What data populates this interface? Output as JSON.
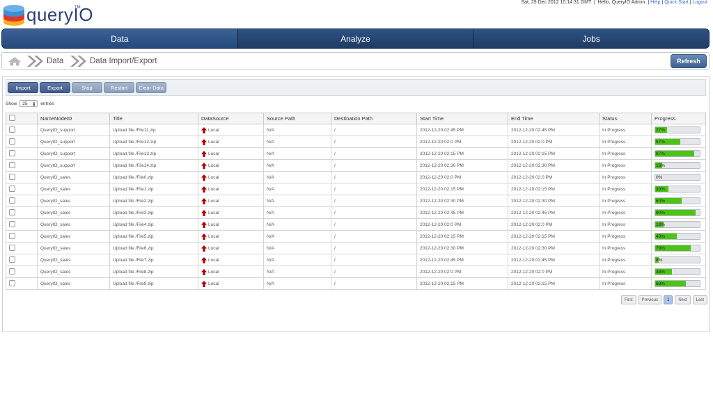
{
  "header": {
    "logo_text": "queryIO",
    "logo_tm": "TM",
    "datetime": "Sat, 29 Dec 2012 10:14:31 GMT",
    "greeting": "Hello,  QueryIO Admin",
    "links": [
      "Help",
      "Quick Start",
      "Logout"
    ]
  },
  "nav": {
    "tabs": [
      "Data",
      "Analyze",
      "Jobs"
    ],
    "active": "Data"
  },
  "breadcrumb": {
    "items": [
      "Data",
      "Data Import/Export"
    ],
    "refresh_label": "Refresh"
  },
  "toolbar": {
    "import_label": "Import",
    "export_label": "Export",
    "stop_label": "Stop",
    "restart_label": "Restart",
    "clear_label": "Clear Data"
  },
  "length": {
    "show_label": "Show",
    "value": "25",
    "entries_label": "entries"
  },
  "table": {
    "columns": [
      "NameNodeID",
      "Title",
      "DataSource",
      "Source Path",
      "Destination Path",
      "Start Time",
      "End Time",
      "Status",
      "Progress"
    ],
    "rows": [
      {
        "node": "QueryIO_support",
        "title": "Upload file /File11.zip",
        "source": "Local",
        "src_path": "N/A",
        "dest_path": "/",
        "start": "2012-12-20 02:45 PM",
        "end": "2012-12-20 02:45 PM",
        "status": "In Progress",
        "progress": 27,
        "progress_label": "27%"
      },
      {
        "node": "QueryIO_support",
        "title": "Upload file /File12.zip",
        "source": "Local",
        "src_path": "N/A",
        "dest_path": "/",
        "start": "2012-12-20 02:0 PM",
        "end": "2012-12-20 02:0 PM",
        "status": "In Progress",
        "progress": 57,
        "progress_label": "57%"
      },
      {
        "node": "QueryIO_support",
        "title": "Upload file /File13.zip",
        "source": "Local",
        "src_path": "N/A",
        "dest_path": "/",
        "start": "2012-12-20 02:15 PM",
        "end": "2012-12-20 02:15 PM",
        "status": "In Progress",
        "progress": 87,
        "progress_label": "87%"
      },
      {
        "node": "QueryIO_support",
        "title": "Upload file /File14.zip",
        "source": "Local",
        "src_path": "N/A",
        "dest_path": "/",
        "start": "2012-12-20 02:30 PM",
        "end": "2012-12-20 02:30 PM",
        "status": "In Progress",
        "progress": 16,
        "progress_label": "16%"
      },
      {
        "node": "QueryIO_sales",
        "title": "Upload file /File0.zip",
        "source": "Local",
        "src_path": "N/A",
        "dest_path": "/",
        "start": "2012-12-20 02:0 PM",
        "end": "2012-12-20 02:0 PM",
        "status": "In Progress",
        "progress": 0,
        "progress_label": "0%"
      },
      {
        "node": "QueryIO_sales",
        "title": "Upload file /File1.zip",
        "source": "Local",
        "src_path": "N/A",
        "dest_path": "/",
        "start": "2012-12-20 02:15 PM",
        "end": "2012-12-20 02:15 PM",
        "status": "In Progress",
        "progress": 30,
        "progress_label": "30%"
      },
      {
        "node": "QueryIO_sales",
        "title": "Upload file /File2.zip",
        "source": "Local",
        "src_path": "N/A",
        "dest_path": "/",
        "start": "2012-12-20 02:30 PM",
        "end": "2012-12-20 02:30 PM",
        "status": "In Progress",
        "progress": 60,
        "progress_label": "60%"
      },
      {
        "node": "QueryIO_sales",
        "title": "Upload file /File3.zip",
        "source": "Local",
        "src_path": "N/A",
        "dest_path": "/",
        "start": "2012-12-20 02:45 PM",
        "end": "2012-12-20 02:45 PM",
        "status": "In Progress",
        "progress": 90,
        "progress_label": "90%"
      },
      {
        "node": "QueryIO_sales",
        "title": "Upload file /File4.zip",
        "source": "Local",
        "src_path": "N/A",
        "dest_path": "/",
        "start": "2012-12-20 02:0 PM",
        "end": "2012-12-20 02:0 PM",
        "status": "In Progress",
        "progress": 19,
        "progress_label": "19%"
      },
      {
        "node": "QueryIO_sales",
        "title": "Upload file /File5.zip",
        "source": "Local",
        "src_path": "N/A",
        "dest_path": "/",
        "start": "2012-12-20 02:15 PM",
        "end": "2012-12-20 02:15 PM",
        "status": "In Progress",
        "progress": 49,
        "progress_label": "49%"
      },
      {
        "node": "QueryIO_sales",
        "title": "Upload file /File6.zip",
        "source": "Local",
        "src_path": "N/A",
        "dest_path": "/",
        "start": "2012-12-20 02:30 PM",
        "end": "2012-12-20 02:30 PM",
        "status": "In Progress",
        "progress": 79,
        "progress_label": "79%"
      },
      {
        "node": "QueryIO_sales",
        "title": "Upload file /File7.zip",
        "source": "Local",
        "src_path": "N/A",
        "dest_path": "/",
        "start": "2012-12-20 02:45 PM",
        "end": "2012-12-20 02:45 PM",
        "status": "In Progress",
        "progress": 8,
        "progress_label": "8%"
      },
      {
        "node": "QueryIO_sales",
        "title": "Upload file /File8.zip",
        "source": "Local",
        "src_path": "N/A",
        "dest_path": "/",
        "start": "2012-12-20 02:0 PM",
        "end": "2012-12-20 02:0 PM",
        "status": "In Progress",
        "progress": 38,
        "progress_label": "38%"
      },
      {
        "node": "QueryIO_sales",
        "title": "Upload file /File9.zip",
        "source": "Local",
        "src_path": "N/A",
        "dest_path": "/",
        "start": "2012-12-20 02:15 PM",
        "end": "2012-12-20 02:15 PM",
        "status": "In Progress",
        "progress": 68,
        "progress_label": "68%"
      }
    ]
  },
  "pager": {
    "first": "First",
    "previous": "Previous",
    "current": "1",
    "next": "Next",
    "last": "Last"
  },
  "colors": {
    "nav_bg": "#1f3d6a",
    "progress_fill": "#4cc417",
    "upload_icon": "#b00000",
    "link": "#3a6fc4"
  }
}
